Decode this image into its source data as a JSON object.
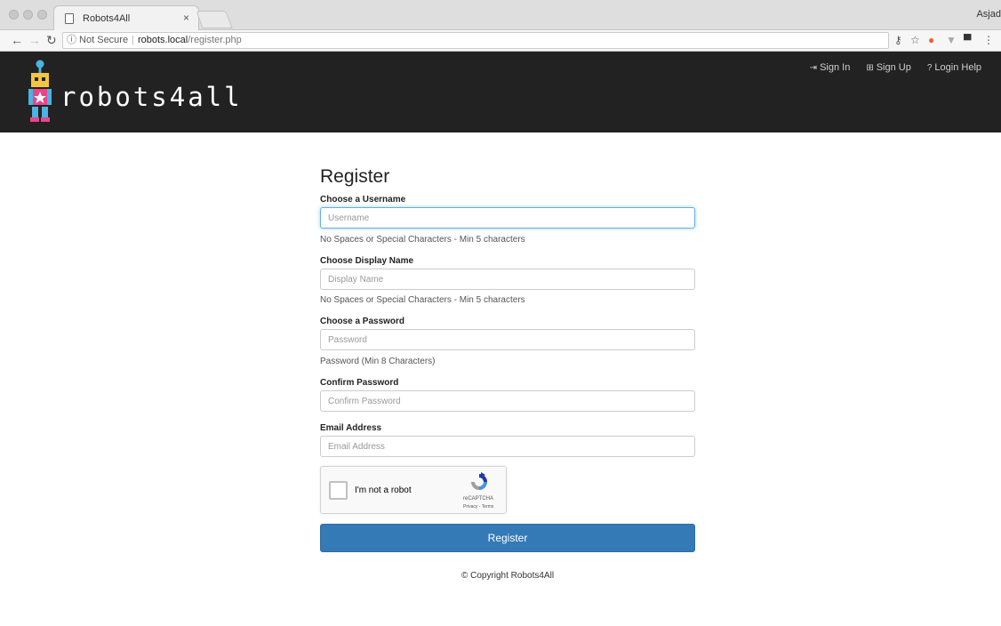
{
  "browser": {
    "tab_title": "Robots4All",
    "tab_close": "×",
    "user_name": "Asjad",
    "address": {
      "security": "ⓘ Not Secure",
      "host": "robots.local",
      "path": "/register.php"
    }
  },
  "header": {
    "brand": "robots4all",
    "nav": [
      {
        "label": "Sign In",
        "icon": "sign-in-icon"
      },
      {
        "label": "Sign Up",
        "icon": "plus-square-icon"
      },
      {
        "label": "Login Help",
        "icon": "question-circle-icon"
      }
    ]
  },
  "form": {
    "title": "Register",
    "username": {
      "label": "Choose a Username",
      "placeholder": "Username",
      "help": "No Spaces or Special Characters - Min 5 characters"
    },
    "display_name": {
      "label": "Choose Display Name",
      "placeholder": "Display Name",
      "help": "No Spaces or Special Characters - Min 5 characters"
    },
    "password": {
      "label": "Choose a Password",
      "placeholder": "Password",
      "help": "Password (Min 8 Characters)"
    },
    "confirm_password": {
      "label": "Confirm Password",
      "placeholder": "Confirm Password"
    },
    "email": {
      "label": "Email Address",
      "placeholder": "Email Address"
    },
    "captcha": {
      "label": "I'm not a robot",
      "brand": "reCAPTCHA",
      "links": "Privacy - Terms"
    },
    "submit_label": "Register"
  },
  "footer": {
    "copyright": "© Copyright Robots4All"
  },
  "colors": {
    "header_bg": "#222222",
    "primary_button": "#337ab7",
    "focus_border": "#66afe9"
  }
}
